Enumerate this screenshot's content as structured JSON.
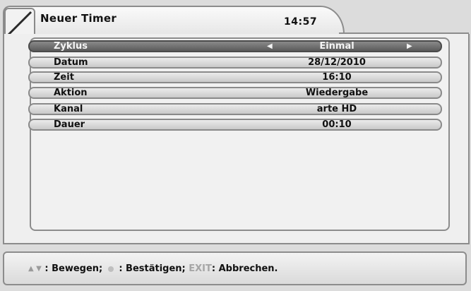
{
  "header": {
    "title": "Neuer Timer",
    "time": "14:57",
    "logo_icon": "slash-logo-icon"
  },
  "fields": [
    {
      "label": "Zyklus",
      "value": "Einmal",
      "selected": true
    },
    {
      "label": "Datum",
      "value": "28/12/2010"
    },
    {
      "label": "Zeit",
      "value": "16:10"
    },
    {
      "label": "Aktion",
      "value": "Wiedergabe"
    },
    {
      "label": "Kanal",
      "value": "arte HD"
    },
    {
      "label": "Dauer",
      "value": "00:10"
    }
  ],
  "help": {
    "nav_icon": "up-down-arrows-icon",
    "move_label": ": Bewegen;",
    "ok_icon": "ok-dot-icon",
    "confirm_label": ": Bestätigen;",
    "exit_key": "EXIT",
    "cancel_label": ": Abbrechen."
  },
  "colors": {
    "selected_row": "#6e6e6e",
    "row": "#d6d6d6",
    "background": "#efefef"
  }
}
